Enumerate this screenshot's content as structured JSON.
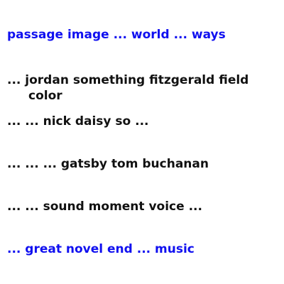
{
  "lines": [
    {
      "text": "passage image ... world ... ways",
      "color": "#1010f0"
    },
    {
      "text_a": "... jordan something fitzgerald field",
      "text_b": "color",
      "color": "#111111"
    },
    {
      "text": "... ... nick daisy so ...",
      "color": "#111111"
    },
    {
      "text": "... ... ... gatsby tom buchanan",
      "color": "#111111"
    },
    {
      "text": "... ... sound moment voice ...",
      "color": "#111111"
    },
    {
      "text": "... great novel end ... music",
      "color": "#1010f0"
    }
  ]
}
